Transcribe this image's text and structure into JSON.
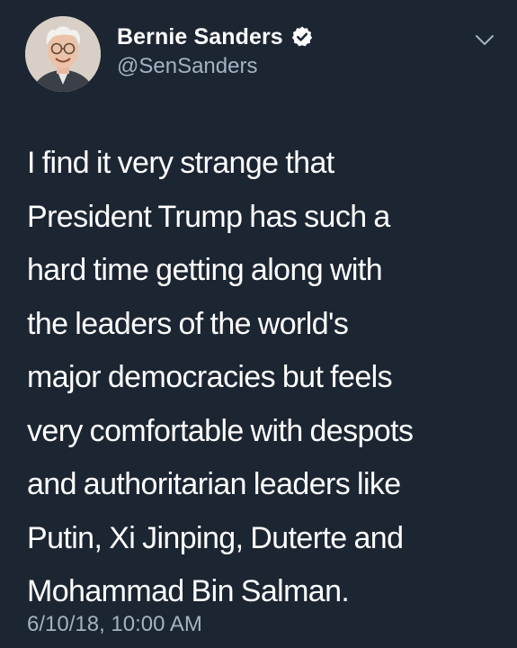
{
  "author": {
    "display_name": "Bernie Sanders",
    "handle": "@SenSanders",
    "verified": true
  },
  "tweet": {
    "text": "I find it very strange that\nPresident Trump has such a\nhard time getting along with\nthe leaders of the world's\nmajor democracies but feels\nvery comfortable with despots\nand authoritarian leaders like\nPutin, Xi Jinping, Duterte and\nMohammad Bin Salman.",
    "timestamp": "6/10/18, 10:00 AM"
  },
  "icons": {
    "verified": "verified-badge-icon",
    "menu": "chevron-down-icon"
  },
  "colors": {
    "background": "#1c2532",
    "text": "#ffffff",
    "secondary_text": "#a3b3c2",
    "verified_badge": "#ffffff"
  }
}
